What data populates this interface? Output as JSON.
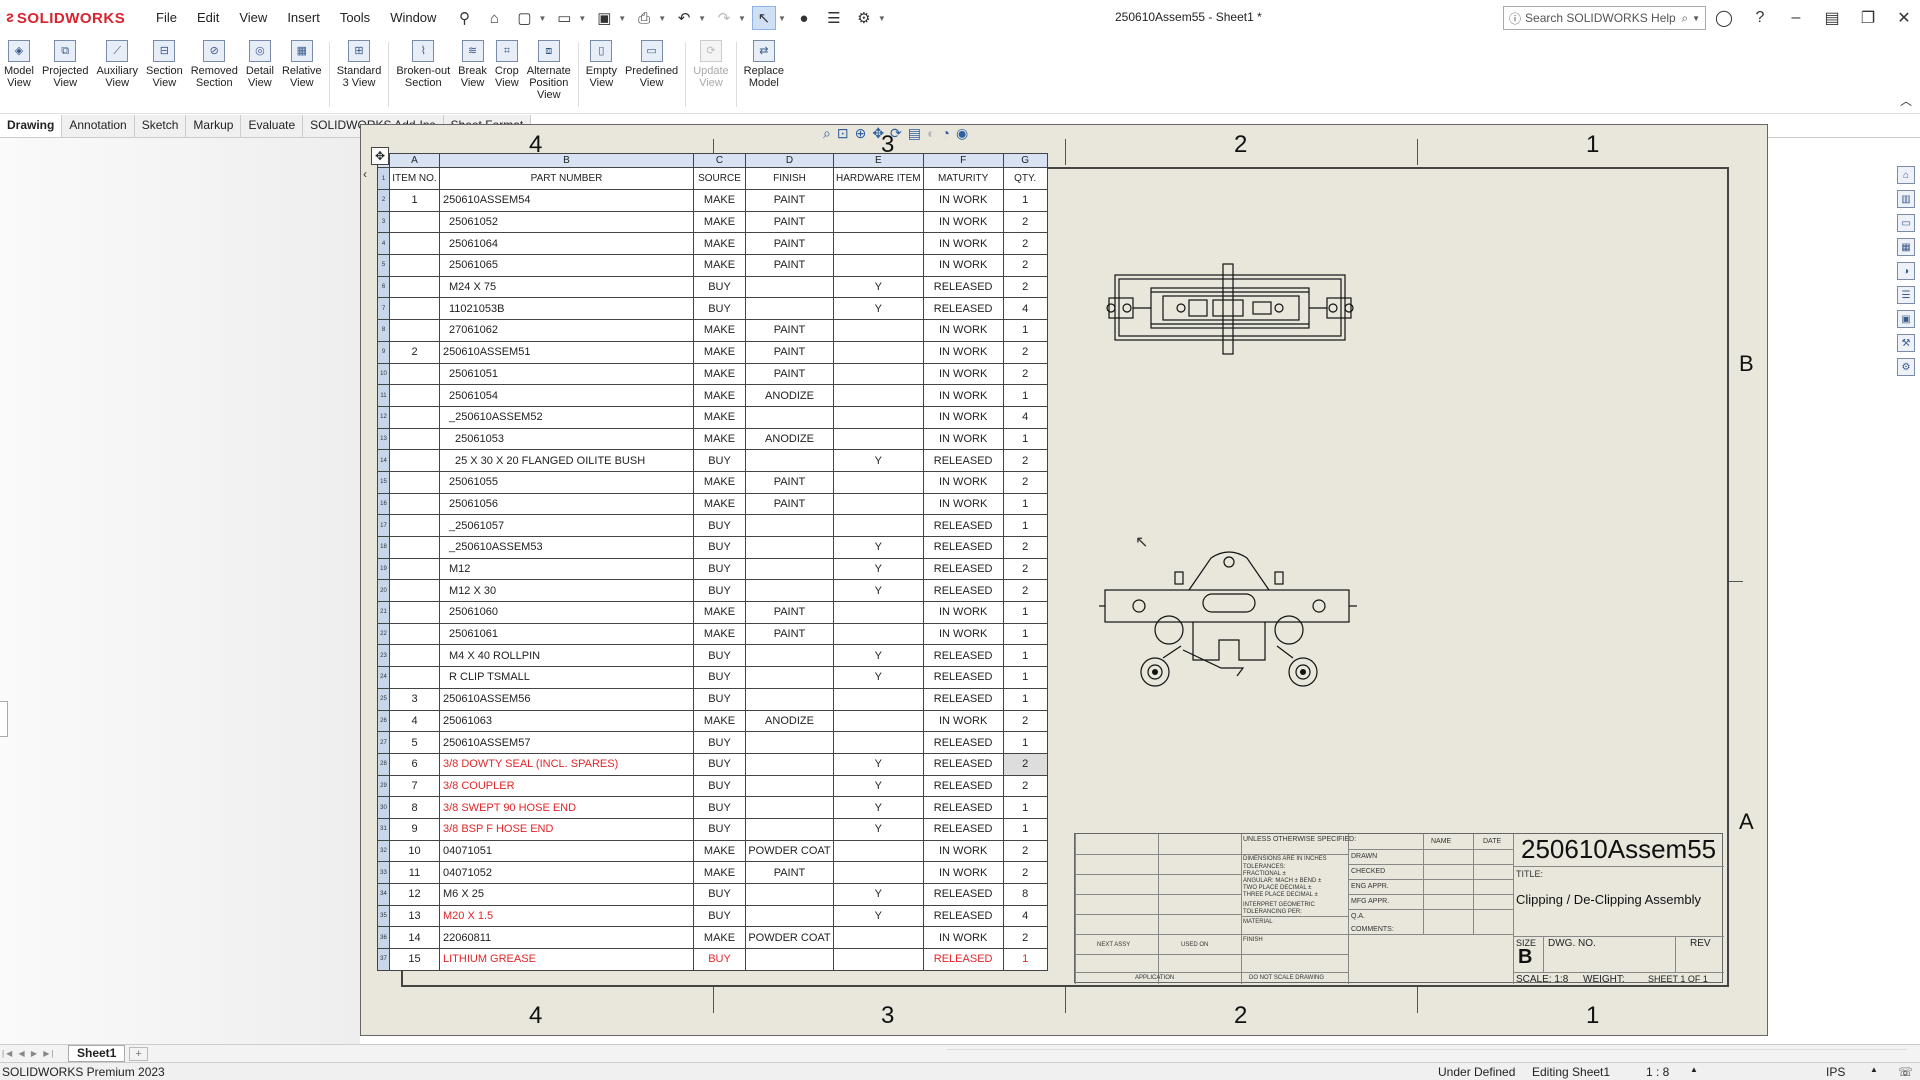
{
  "app": {
    "logo_text": "SOLIDWORKS",
    "doc_title": "250610Assem55 - Sheet1 *",
    "search_placeholder": "Search SOLIDWORKS Help",
    "menu": [
      "File",
      "Edit",
      "View",
      "Insert",
      "Tools",
      "Window"
    ]
  },
  "ribbon": [
    {
      "line1": "Model",
      "line2": "View",
      "line3": "",
      "icon": "model-view-icon",
      "enabled": true
    },
    {
      "line1": "Projected",
      "line2": "View",
      "line3": "",
      "icon": "projected-view-icon",
      "enabled": true
    },
    {
      "line1": "Auxiliary",
      "line2": "View",
      "line3": "",
      "icon": "auxiliary-view-icon",
      "enabled": true
    },
    {
      "line1": "Section",
      "line2": "View",
      "line3": "",
      "icon": "section-view-icon",
      "enabled": true
    },
    {
      "line1": "Removed",
      "line2": "Section",
      "line3": "",
      "icon": "removed-section-icon",
      "enabled": true
    },
    {
      "line1": "Detail",
      "line2": "View",
      "line3": "",
      "icon": "detail-view-icon",
      "enabled": true
    },
    {
      "line1": "Relative",
      "line2": "View",
      "line3": "",
      "icon": "relative-view-icon",
      "enabled": true
    },
    {
      "line1": "Standard",
      "line2": "3 View",
      "line3": "",
      "icon": "standard-3-view-icon",
      "enabled": true
    },
    {
      "line1": "Broken-out",
      "line2": "Section",
      "line3": "",
      "icon": "broken-out-section-icon",
      "enabled": true
    },
    {
      "line1": "Break",
      "line2": "View",
      "line3": "",
      "icon": "break-view-icon",
      "enabled": true
    },
    {
      "line1": "Crop",
      "line2": "View",
      "line3": "",
      "icon": "crop-view-icon",
      "enabled": true
    },
    {
      "line1": "Alternate",
      "line2": "Position",
      "line3": "View",
      "icon": "alternate-position-view-icon",
      "enabled": true
    },
    {
      "line1": "Empty",
      "line2": "View",
      "line3": "",
      "icon": "empty-view-icon",
      "enabled": true
    },
    {
      "line1": "Predefined",
      "line2": "View",
      "line3": "",
      "icon": "predefined-view-icon",
      "enabled": true
    },
    {
      "line1": "Update",
      "line2": "View",
      "line3": "",
      "icon": "update-view-icon",
      "enabled": false
    },
    {
      "line1": "Replace",
      "line2": "Model",
      "line3": "",
      "icon": "replace-model-icon",
      "enabled": true
    }
  ],
  "tabs": [
    "Drawing",
    "Annotation",
    "Sketch",
    "Markup",
    "Evaluate",
    "SOLIDWORKS Add-Ins",
    "Sheet Format"
  ],
  "active_tab": "Drawing",
  "sheet": {
    "zones_top": [
      "4",
      "3",
      "2",
      "1"
    ],
    "zones_bottom": [
      "4",
      "3",
      "2",
      "1"
    ],
    "zones_right": [
      "B",
      "A"
    ]
  },
  "bom": {
    "col_letters": [
      "A",
      "B",
      "C",
      "D",
      "E",
      "F",
      "G"
    ],
    "headers": [
      "ITEM NO.",
      "PART NUMBER",
      "SOURCE",
      "FINISH",
      "HARDWARE ITEM",
      "MATURITY",
      "QTY."
    ],
    "rows": [
      {
        "item": "1",
        "part": "250610ASSEM54",
        "source": "MAKE",
        "finish": "PAINT",
        "hw": "",
        "maturity": "IN WORK",
        "qty": "1",
        "indent": 0,
        "red": false
      },
      {
        "item": "",
        "part": "25061052",
        "source": "MAKE",
        "finish": "PAINT",
        "hw": "",
        "maturity": "IN WORK",
        "qty": "2",
        "indent": 1,
        "red": false
      },
      {
        "item": "",
        "part": "25061064",
        "source": "MAKE",
        "finish": "PAINT",
        "hw": "",
        "maturity": "IN WORK",
        "qty": "2",
        "indent": 1,
        "red": false
      },
      {
        "item": "",
        "part": "25061065",
        "source": "MAKE",
        "finish": "PAINT",
        "hw": "",
        "maturity": "IN WORK",
        "qty": "2",
        "indent": 1,
        "red": false
      },
      {
        "item": "",
        "part": "M24 X 75",
        "source": "BUY",
        "finish": "",
        "hw": "Y",
        "maturity": "RELEASED",
        "qty": "2",
        "indent": 1,
        "red": false
      },
      {
        "item": "",
        "part": "11021053B",
        "source": "BUY",
        "finish": "",
        "hw": "Y",
        "maturity": "RELEASED",
        "qty": "4",
        "indent": 1,
        "red": false
      },
      {
        "item": "",
        "part": "27061062",
        "source": "MAKE",
        "finish": "PAINT",
        "hw": "",
        "maturity": "IN WORK",
        "qty": "1",
        "indent": 1,
        "red": false
      },
      {
        "item": "2",
        "part": "250610ASSEM51",
        "source": "MAKE",
        "finish": "PAINT",
        "hw": "",
        "maturity": "IN WORK",
        "qty": "2",
        "indent": 0,
        "red": false
      },
      {
        "item": "",
        "part": "25061051",
        "source": "MAKE",
        "finish": "PAINT",
        "hw": "",
        "maturity": "IN WORK",
        "qty": "2",
        "indent": 1,
        "red": false
      },
      {
        "item": "",
        "part": "25061054",
        "source": "MAKE",
        "finish": "ANODIZE",
        "hw": "",
        "maturity": "IN WORK",
        "qty": "1",
        "indent": 1,
        "red": false
      },
      {
        "item": "",
        "part": "_250610ASSEM52",
        "source": "MAKE",
        "finish": "",
        "hw": "",
        "maturity": "IN WORK",
        "qty": "4",
        "indent": 1,
        "red": false
      },
      {
        "item": "",
        "part": "25061053",
        "source": "MAKE",
        "finish": "ANODIZE",
        "hw": "",
        "maturity": "IN WORK",
        "qty": "1",
        "indent": 2,
        "red": false
      },
      {
        "item": "",
        "part": "25 X 30 X 20 FLANGED OILITE BUSH",
        "source": "BUY",
        "finish": "",
        "hw": "Y",
        "maturity": "RELEASED",
        "qty": "2",
        "indent": 2,
        "red": false
      },
      {
        "item": "",
        "part": "25061055",
        "source": "MAKE",
        "finish": "PAINT",
        "hw": "",
        "maturity": "IN WORK",
        "qty": "2",
        "indent": 1,
        "red": false
      },
      {
        "item": "",
        "part": "25061056",
        "source": "MAKE",
        "finish": "PAINT",
        "hw": "",
        "maturity": "IN WORK",
        "qty": "1",
        "indent": 1,
        "red": false
      },
      {
        "item": "",
        "part": "_25061057",
        "source": "BUY",
        "finish": "",
        "hw": "",
        "maturity": "RELEASED",
        "qty": "1",
        "indent": 1,
        "red": false
      },
      {
        "item": "",
        "part": "_250610ASSEM53",
        "source": "BUY",
        "finish": "",
        "hw": "Y",
        "maturity": "RELEASED",
        "qty": "2",
        "indent": 1,
        "red": false
      },
      {
        "item": "",
        "part": "M12",
        "source": "BUY",
        "finish": "",
        "hw": "Y",
        "maturity": "RELEASED",
        "qty": "2",
        "indent": 1,
        "red": false
      },
      {
        "item": "",
        "part": "M12 X 30",
        "source": "BUY",
        "finish": "",
        "hw": "Y",
        "maturity": "RELEASED",
        "qty": "2",
        "indent": 1,
        "red": false
      },
      {
        "item": "",
        "part": "25061060",
        "source": "MAKE",
        "finish": "PAINT",
        "hw": "",
        "maturity": "IN WORK",
        "qty": "1",
        "indent": 1,
        "red": false
      },
      {
        "item": "",
        "part": "25061061",
        "source": "MAKE",
        "finish": "PAINT",
        "hw": "",
        "maturity": "IN WORK",
        "qty": "1",
        "indent": 1,
        "red": false
      },
      {
        "item": "",
        "part": "M4 X 40 ROLLPIN",
        "source": "BUY",
        "finish": "",
        "hw": "Y",
        "maturity": "RELEASED",
        "qty": "1",
        "indent": 1,
        "red": false
      },
      {
        "item": "",
        "part": "R CLIP TSMALL",
        "source": "BUY",
        "finish": "",
        "hw": "Y",
        "maturity": "RELEASED",
        "qty": "1",
        "indent": 1,
        "red": false
      },
      {
        "item": "3",
        "part": "250610ASSEM56",
        "source": "BUY",
        "finish": "",
        "hw": "",
        "maturity": "RELEASED",
        "qty": "1",
        "indent": 0,
        "red": false
      },
      {
        "item": "4",
        "part": "25061063",
        "source": "MAKE",
        "finish": "ANODIZE",
        "hw": "",
        "maturity": "IN WORK",
        "qty": "2",
        "indent": 0,
        "red": false
      },
      {
        "item": "5",
        "part": "250610ASSEM57",
        "source": "BUY",
        "finish": "",
        "hw": "",
        "maturity": "RELEASED",
        "qty": "1",
        "indent": 0,
        "red": false
      },
      {
        "item": "6",
        "part": "3/8 DOWTY SEAL (INCL. SPARES)",
        "source": "BUY",
        "finish": "",
        "hw": "Y",
        "maturity": "RELEASED",
        "qty": "2",
        "indent": 0,
        "red": true,
        "qty_selected": true
      },
      {
        "item": "7",
        "part": "3/8 COUPLER",
        "source": "BUY",
        "finish": "",
        "hw": "Y",
        "maturity": "RELEASED",
        "qty": "2",
        "indent": 0,
        "red": true
      },
      {
        "item": "8",
        "part": "3/8 SWEPT 90 HOSE END",
        "source": "BUY",
        "finish": "",
        "hw": "Y",
        "maturity": "RELEASED",
        "qty": "1",
        "indent": 0,
        "red": true
      },
      {
        "item": "9",
        "part": "3/8 BSP F HOSE END",
        "source": "BUY",
        "finish": "",
        "hw": "Y",
        "maturity": "RELEASED",
        "qty": "1",
        "indent": 0,
        "red": true
      },
      {
        "item": "10",
        "part": "04071051",
        "source": "MAKE",
        "finish": "POWDER COAT",
        "hw": "",
        "maturity": "IN WORK",
        "qty": "2",
        "indent": 0,
        "red": false
      },
      {
        "item": "11",
        "part": "04071052",
        "source": "MAKE",
        "finish": "PAINT",
        "hw": "",
        "maturity": "IN WORK",
        "qty": "2",
        "indent": 0,
        "red": false
      },
      {
        "item": "12",
        "part": "M6 X 25",
        "source": "BUY",
        "finish": "",
        "hw": "Y",
        "maturity": "RELEASED",
        "qty": "8",
        "indent": 0,
        "red": false
      },
      {
        "item": "13",
        "part": "M20 X 1.5",
        "source": "BUY",
        "finish": "",
        "hw": "Y",
        "maturity": "RELEASED",
        "qty": "4",
        "indent": 0,
        "red": true
      },
      {
        "item": "14",
        "part": "22060811",
        "source": "MAKE",
        "finish": "POWDER COAT",
        "hw": "",
        "maturity": "IN WORK",
        "qty": "2",
        "indent": 0,
        "red": false
      },
      {
        "item": "15",
        "part": "LITHIUM GREASE",
        "source": "BUY",
        "finish": "",
        "hw": "",
        "maturity": "RELEASED",
        "qty": "1",
        "indent": 0,
        "red": true,
        "all_red": true
      }
    ]
  },
  "titleblock": {
    "unless": "UNLESS OTHERWISE SPECIFIED:",
    "dims": "DIMENSIONS ARE IN INCHES",
    "tol": "TOLERANCES:",
    "frac": "FRACTIONAL ±",
    "ang": "ANGULAR: MACH ±   BEND ±",
    "two": "TWO PLACE DECIMAL   ±",
    "three": "THREE PLACE DECIMAL  ±",
    "interp": "INTERPRET GEOMETRIC",
    "interp2": "TOLERANCING PER:",
    "material": "MATERIAL",
    "finish": "FINISH",
    "next_assy": "NEXT ASSY",
    "used_on": "USED ON",
    "application": "APPLICATION",
    "dnsd": "DO NOT SCALE DRAWING",
    "name": "NAME",
    "date": "DATE",
    "drawn": "DRAWN",
    "checked": "CHECKED",
    "eng": "ENG APPR.",
    "mfg": "MFG APPR.",
    "qa": "Q.A.",
    "comments": "COMMENTS:",
    "part_no": "250610Assem55",
    "title_label": "TITLE:",
    "title": "Clipping / De-Clipping Assembly",
    "size_label": "SIZE",
    "size": "B",
    "dwg_label": "DWG.  NO.",
    "rev_label": "REV",
    "scale": "SCALE: 1:8",
    "weight": "WEIGHT:",
    "sheet": "SHEET 1 OF 1"
  },
  "sheet_tabs": {
    "active": "Sheet1"
  },
  "status": {
    "product": "SOLIDWORKS Premium 2023",
    "state": "Under Defined",
    "editing": "Editing Sheet1",
    "scale": "1 : 8",
    "units": "IPS"
  }
}
